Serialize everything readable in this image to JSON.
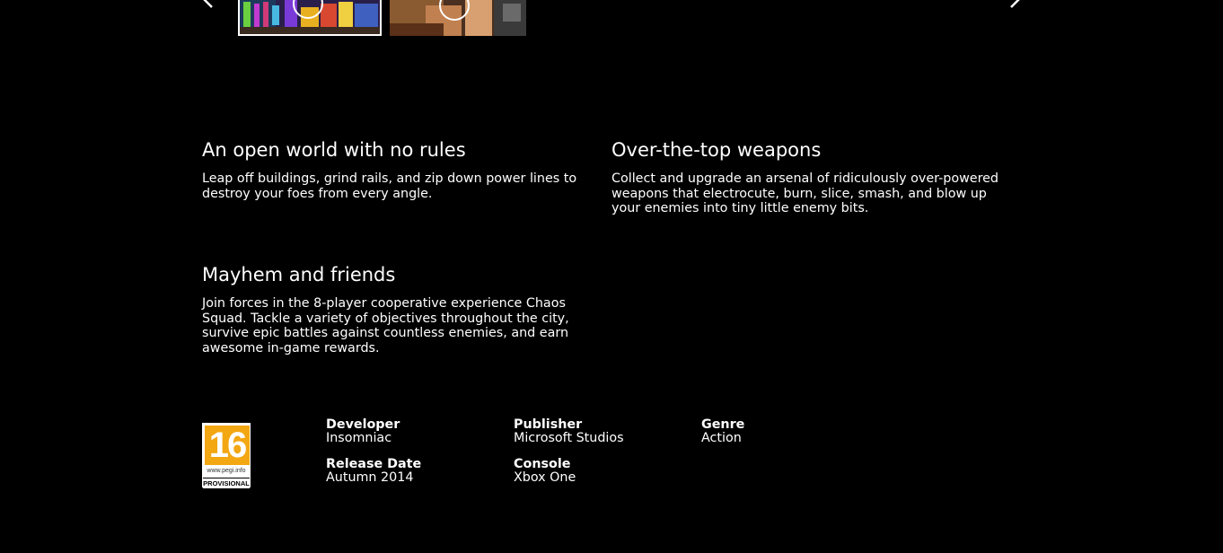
{
  "thumbnails": [
    {
      "name": "gameplay-video-1",
      "selected": true
    },
    {
      "name": "gameplay-video-2",
      "selected": false
    }
  ],
  "features": [
    {
      "title": "An open world with no rules",
      "body": "Leap off buildings, grind rails, and zip down power lines to destroy your foes from every angle."
    },
    {
      "title": "Over-the-top weapons",
      "body": "Collect and upgrade an arsenal of ridiculously over-powered weapons that electrocute, burn, slice, smash, and blow up your enemies into tiny little enemy bits."
    },
    {
      "title": "Mayhem and friends",
      "body": "Join forces in the 8-player cooperative experience Chaos Squad. Tackle a variety of objectives throughout the city, survive epic battles against countless enemies, and earn awesome in-game rewards."
    }
  ],
  "rating": {
    "age": "16",
    "site": "www.pegi.info",
    "status": "PROVISIONAL",
    "color": "#f3a712"
  },
  "details": {
    "developer": {
      "label": "Developer",
      "value": "Insomniac"
    },
    "publisher": {
      "label": "Publisher",
      "value": "Microsoft Studios"
    },
    "genre": {
      "label": "Genre",
      "value": "Action"
    },
    "release_date": {
      "label": "Release Date",
      "value": "Autumn 2014"
    },
    "console": {
      "label": "Console",
      "value": "Xbox One"
    }
  }
}
